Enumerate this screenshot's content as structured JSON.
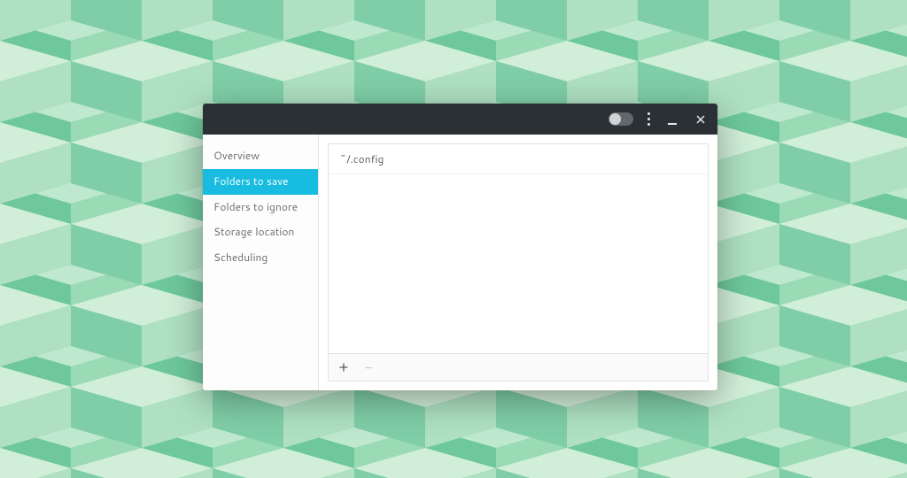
{
  "colors": {
    "accent": "#17bce0",
    "titlebar": "#2b3034"
  },
  "titlebar": {
    "toggle_on": false
  },
  "sidebar": {
    "items": [
      {
        "label": "Overview",
        "selected": false
      },
      {
        "label": "Folders to save",
        "selected": true
      },
      {
        "label": "Folders to ignore",
        "selected": false
      },
      {
        "label": "Storage location",
        "selected": false
      },
      {
        "label": "Scheduling",
        "selected": false
      }
    ]
  },
  "main": {
    "folders": [
      "~/.config"
    ],
    "toolbar": {
      "add_label": "+",
      "remove_label": "−",
      "remove_enabled": false
    }
  }
}
